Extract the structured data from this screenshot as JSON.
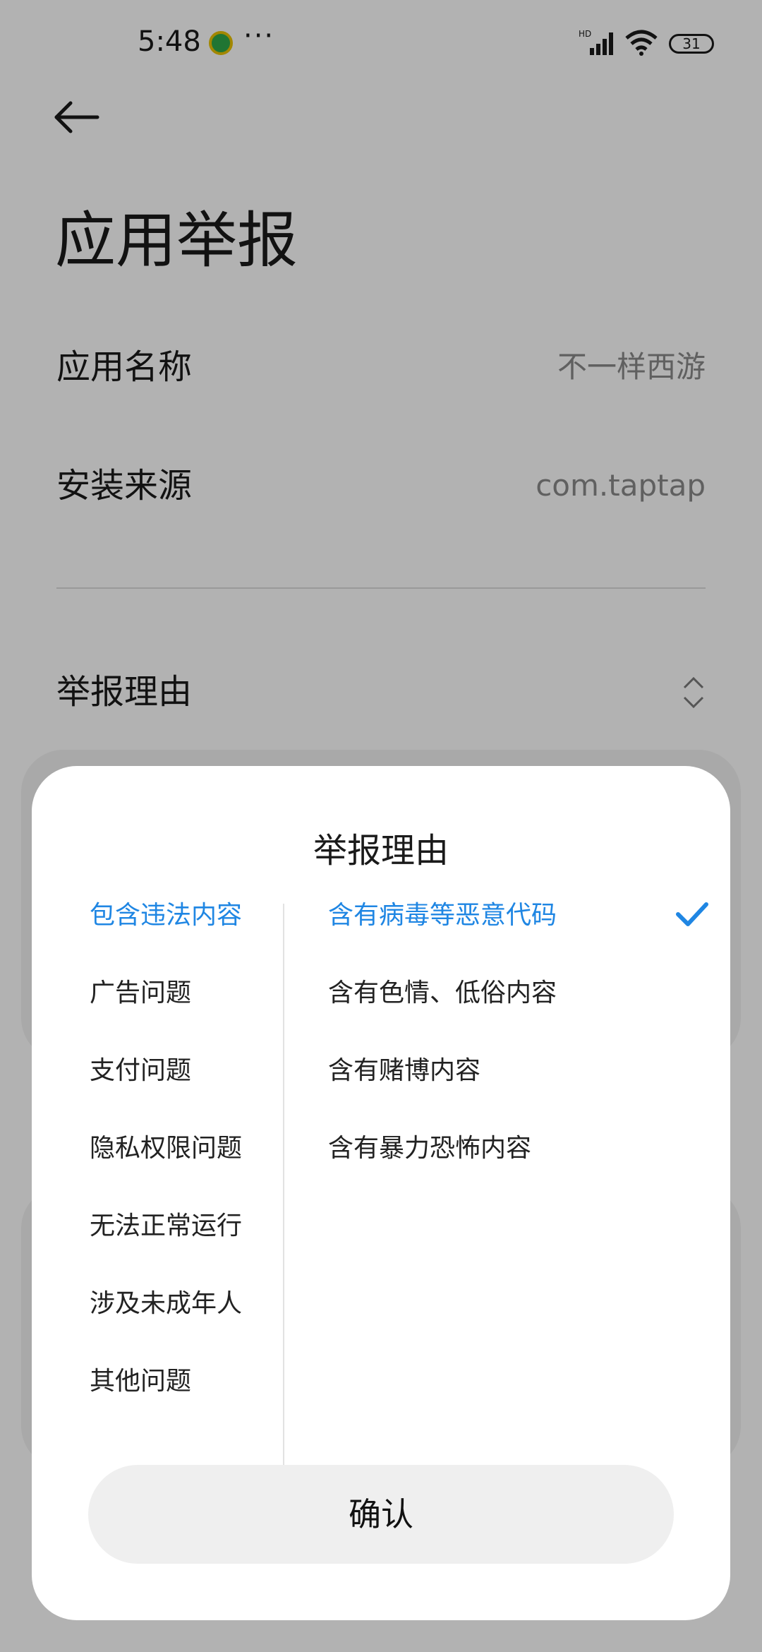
{
  "status": {
    "time": "5:48",
    "overflow_dots": "···",
    "network_label": "HD",
    "battery": "31"
  },
  "page": {
    "title": "应用举报",
    "rows": [
      {
        "label": "应用名称",
        "value": "不一样西游"
      },
      {
        "label": "安装来源",
        "value": "com.taptap"
      }
    ],
    "reason_label": "举报理由"
  },
  "sheet": {
    "title": "举报理由",
    "categories": [
      "包含违法内容",
      "广告问题",
      "支付问题",
      "隐私权限问题",
      "无法正常运行",
      "涉及未成年人",
      "其他问题"
    ],
    "selected_category": "包含违法内容",
    "subreasons": [
      "含有病毒等恶意代码",
      "含有色情、低俗内容",
      "含有赌博内容",
      "含有暴力恐怖内容"
    ],
    "selected_subreason": "含有病毒等恶意代码",
    "confirm_label": "确认"
  },
  "colors": {
    "accent": "#1f86e3",
    "dim_overlay": "rgba(0,0,0,0.30)"
  },
  "icons": [
    "back-arrow-icon",
    "updown-chevron-icon",
    "checkmark-icon",
    "signal-icon",
    "wifi-icon",
    "battery-icon"
  ]
}
